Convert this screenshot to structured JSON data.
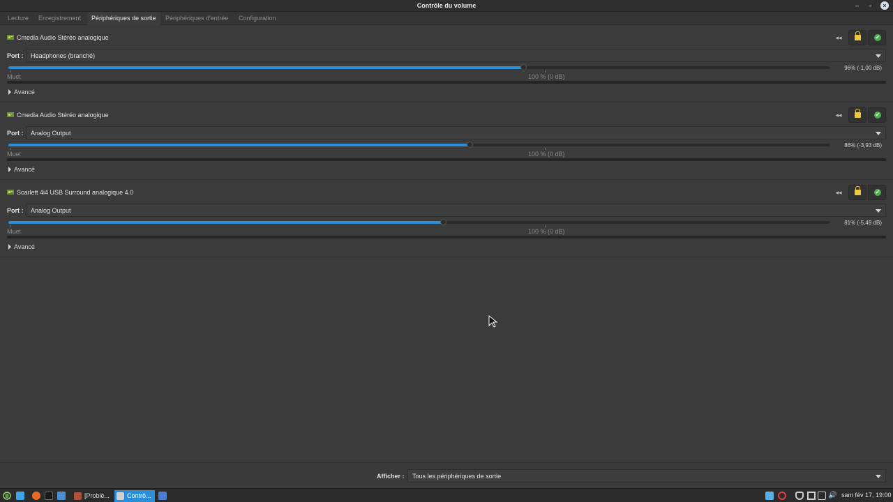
{
  "window": {
    "title": "Contrôle du volume",
    "minimize": "–",
    "maximize": "▫",
    "close": "×"
  },
  "tabs": [
    {
      "label": "Lecture"
    },
    {
      "label": "Enregistrement"
    },
    {
      "label": "Périphériques de sortie"
    },
    {
      "label": "Périphériques d'entrée"
    },
    {
      "label": "Configuration"
    }
  ],
  "active_tab": "Périphériques de sortie",
  "port_label": "Port :",
  "mute_mark": "Muet",
  "hundred_mark": "100 % (0 dB)",
  "advanced_label": "Avancé",
  "devices": [
    {
      "name": "Cmedia Audio Stéréo analogique",
      "port": "Headphones (branché)",
      "volume_percent": 96,
      "readout": "96% (-1,00 dB)"
    },
    {
      "name": "Cmedia Audio Stéréo analogique",
      "port": "Analog Output",
      "volume_percent": 86,
      "readout": "86% (-3,93 dB)"
    },
    {
      "name": "Scarlett 4i4 USB Surround analogique 4.0",
      "port": "Analog Output",
      "volume_percent": 81,
      "readout": "81% (-5,49 dB)"
    }
  ],
  "footer": {
    "show_label": "Afficher :",
    "show_value": "Tous les périphériques de sortie"
  },
  "taskbar": {
    "tasks": [
      {
        "label": "[Problè..."
      },
      {
        "label": "Contrô..."
      }
    ],
    "clock": "sam fév 17, 19:00"
  },
  "colors": {
    "accent": "#2b8ed6",
    "lock": "#f0c83a",
    "default_check": "#4caf50"
  }
}
